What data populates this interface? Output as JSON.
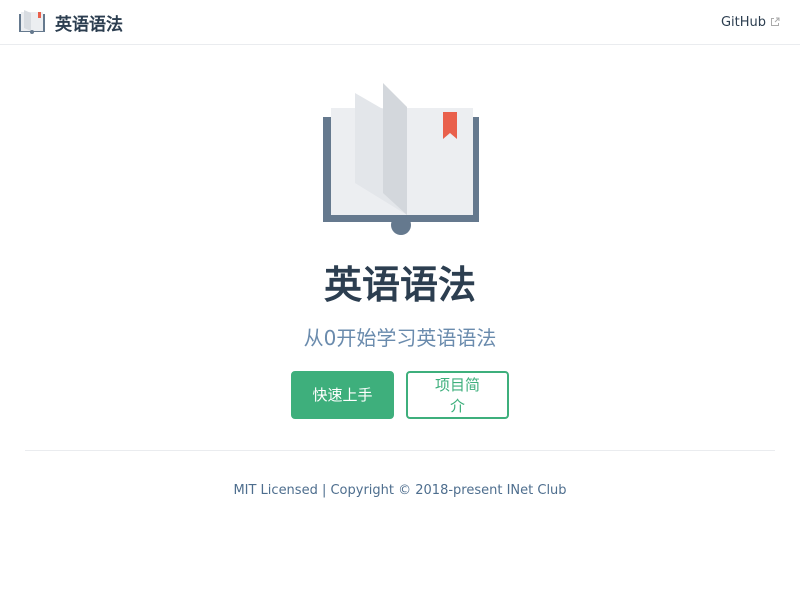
{
  "navbar": {
    "site_name": "英语语法",
    "links": [
      {
        "label": "GitHub",
        "icon": "outbound-link-icon"
      }
    ]
  },
  "hero": {
    "image_icon": "open-book-icon",
    "title": "英语语法",
    "description": "从0开始学习英语语法",
    "actions": [
      {
        "label": "快速上手",
        "style": "primary"
      },
      {
        "label": "项目简介",
        "style": "secondary"
      }
    ]
  },
  "footer": {
    "text": "MIT Licensed | Copyright © 2018-present INet Club"
  },
  "colors": {
    "accent": "#3eaf7c",
    "text": "#2c3e50",
    "description": "#6a8bad",
    "book_cover": "#65798e",
    "bookmark": "#e9604c"
  }
}
